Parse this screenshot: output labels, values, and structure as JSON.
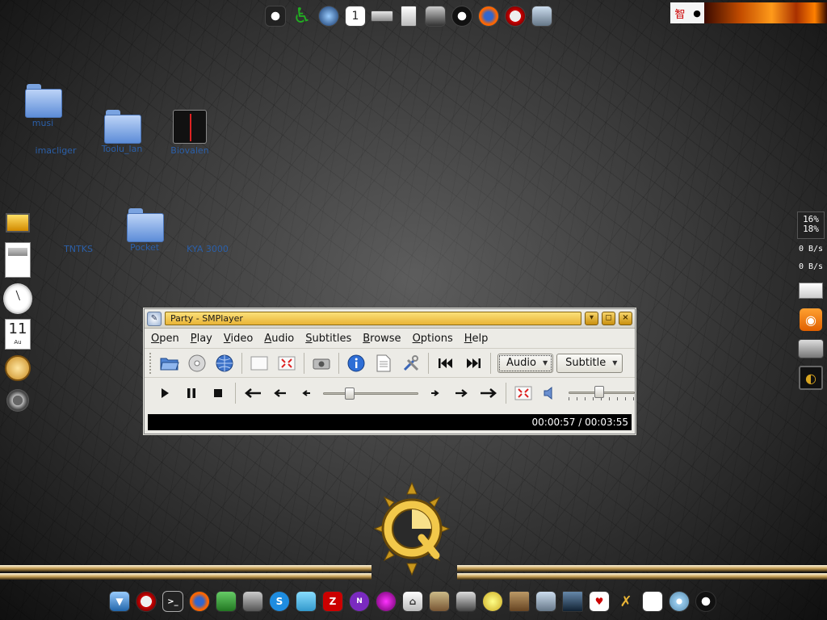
{
  "desktop": {
    "icons": [
      {
        "label": "musi",
        "kind": "folder"
      },
      {
        "label": "imacliger",
        "kind": "folder"
      },
      {
        "label": "Toolu_lan",
        "kind": "folder"
      },
      {
        "label": "Biovalen",
        "kind": "radio"
      },
      {
        "label": "TNTKS",
        "kind": "folder"
      },
      {
        "label": "Pocket",
        "kind": "folder"
      },
      {
        "label": "KYA 3000",
        "kind": "folder"
      }
    ]
  },
  "top_tray": {
    "cn_glyph": "智"
  },
  "calendar": {
    "day": "11",
    "month": "Au"
  },
  "system_monitor": {
    "cpu1": "16%",
    "cpu2": "18%",
    "net_down": "0 B/s",
    "net_up": "0 B/s"
  },
  "window": {
    "title": "Party - SMPlayer",
    "buttons": {
      "minimize": "▾",
      "maximize": "◻",
      "close": "×"
    },
    "menu": [
      "Open",
      "Play",
      "Video",
      "Audio",
      "Subtitles",
      "Browse",
      "Options",
      "Help"
    ],
    "audio_combo": "Audio",
    "subtitle_combo": "Subtitle",
    "seek_fraction": 0.25,
    "volume_fraction": 0.45,
    "time": "00:00:57 / 00:03:55"
  },
  "colors": {
    "accent": "#e9b436",
    "desktop": "#3c3c3c",
    "timebar": "#000000"
  }
}
